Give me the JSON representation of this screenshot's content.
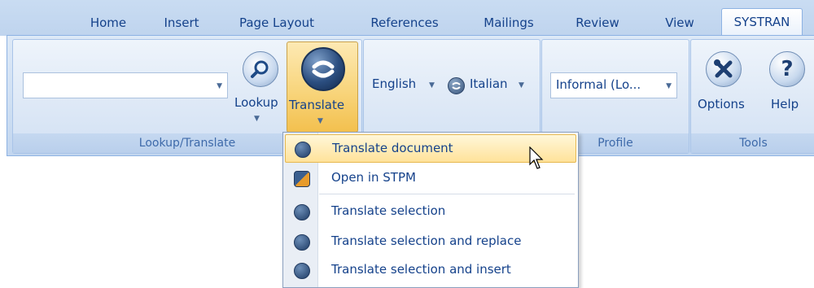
{
  "tabs": [
    "Home",
    "Insert",
    "Page Layout",
    "References",
    "Mailings",
    "Review",
    "View",
    "SYSTRAN"
  ],
  "active_tab": "SYSTRAN",
  "groups": {
    "lookup_translate": {
      "caption": "Lookup/Translate",
      "lookup_label": "Lookup",
      "translate_label": "Translate",
      "search_value": ""
    },
    "languages": {
      "source": "English",
      "target": "Italian"
    },
    "profile": {
      "caption": "Profile",
      "value": "Informal (Lo..."
    },
    "tools": {
      "caption": "Tools",
      "options_label": "Options",
      "help_label": "Help"
    }
  },
  "translate_menu": {
    "items": [
      {
        "label": "Translate document",
        "icon": "systran-icon",
        "highlighted": true
      },
      {
        "label": "Open in STPM",
        "icon": "stpm-icon"
      },
      {
        "label": "Translate selection",
        "icon": "systran-icon"
      },
      {
        "label": "Translate selection and replace",
        "icon": "systran-replace-icon"
      },
      {
        "label": "Translate selection and insert",
        "icon": "systran-insert-icon"
      }
    ]
  },
  "colors": {
    "ribbon": "#d0e0f3",
    "text": "#15428b",
    "highlight": "#ffe29a",
    "active_button": "#f8d57c"
  }
}
